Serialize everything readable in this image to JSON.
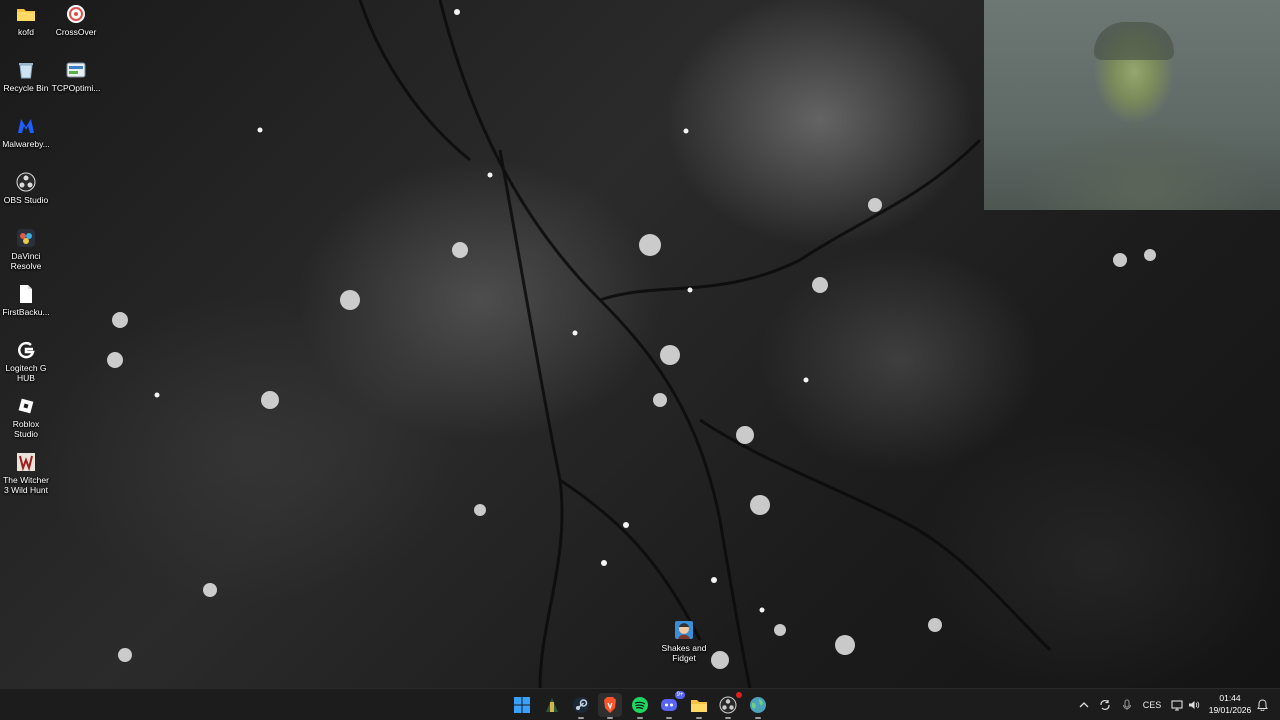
{
  "desktop_icons": [
    {
      "label": "kofd",
      "icon": "folder-icon"
    },
    {
      "label": "CrossOver",
      "icon": "crossover-icon"
    },
    {
      "label": "Recycle Bin",
      "icon": "recycle-bin-icon"
    },
    {
      "label": "TCPOptimi...",
      "icon": "tcpoptimizer-icon"
    },
    {
      "label": "Malwareby...",
      "icon": "malwarebytes-icon"
    },
    {
      "label": "OBS Studio",
      "icon": "obs-studio-icon"
    },
    {
      "label": "DaVinci Resolve",
      "icon": "davinci-resolve-icon"
    },
    {
      "label": "FirstBacku...",
      "icon": "file-icon"
    },
    {
      "label": "Logitech G HUB",
      "icon": "logitech-g-hub-icon"
    },
    {
      "label": "Roblox Studio",
      "icon": "roblox-studio-icon"
    },
    {
      "label": "The Witcher 3 Wild Hunt",
      "icon": "witcher-3-icon"
    },
    {
      "label": "Shakes and Fidget",
      "icon": "shakes-and-fidget-icon"
    }
  ],
  "taskbar": {
    "apps": [
      {
        "name": "Start",
        "icon": "windows-start-icon"
      },
      {
        "name": "Elden Ring",
        "icon": "game-launcher-icon"
      },
      {
        "name": "Steam",
        "icon": "steam-icon"
      },
      {
        "name": "Brave",
        "icon": "brave-browser-icon"
      },
      {
        "name": "Spotify",
        "icon": "spotify-icon"
      },
      {
        "name": "Discord",
        "icon": "discord-icon",
        "badge": "9+"
      },
      {
        "name": "File Explorer",
        "icon": "file-explorer-icon"
      },
      {
        "name": "OBS Studio",
        "icon": "obs-studio-icon"
      },
      {
        "name": "Browser",
        "icon": "globe-icon"
      }
    ],
    "tray": {
      "language": "CES",
      "time": "01:44",
      "date": "19/01/2026"
    }
  },
  "colors": {
    "taskbar_bg": "#1c1c1c",
    "spotify": "#1ed760",
    "discord": "#5865f2",
    "brave": "#fb542b",
    "folder": "#f5c242",
    "windows_blue": "#3aa0ff"
  }
}
